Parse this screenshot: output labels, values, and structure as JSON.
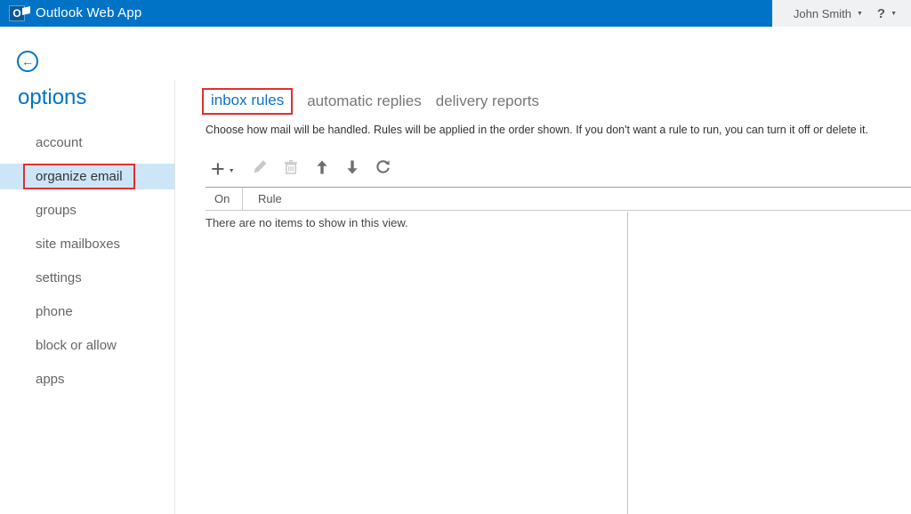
{
  "glyphs": {
    "caret_down": "▼",
    "plus": "+",
    "back_arrow": "←"
  },
  "accent_color": "#0173C7",
  "topbar": {
    "logo_letter": "O",
    "app_title": "Outlook Web App",
    "user_name": "John Smith",
    "help_label": "?",
    "bar_color": "#0173C7",
    "user_area_bg": "#EFF1F2"
  },
  "sidebar": {
    "title": "options",
    "active_item_bg": "#CDE6F7",
    "items": [
      {
        "label": "account",
        "active": false
      },
      {
        "label": "organize email",
        "active": true,
        "annotated": true
      },
      {
        "label": "groups",
        "active": false
      },
      {
        "label": "site mailboxes",
        "active": false
      },
      {
        "label": "settings",
        "active": false
      },
      {
        "label": "phone",
        "active": false
      },
      {
        "label": "block or allow",
        "active": false
      },
      {
        "label": "apps",
        "active": false
      }
    ]
  },
  "main": {
    "tabs": [
      {
        "label": "inbox rules",
        "active": true,
        "annotated": true
      },
      {
        "label": "automatic replies",
        "active": false
      },
      {
        "label": "delivery reports",
        "active": false
      }
    ],
    "description": "Choose how mail will be handled. Rules will be applied in the order shown. If you don't want a rule to run, you can turn it off or delete it.",
    "toolbar": {
      "buttons": [
        {
          "name": "new",
          "icon": "plus-icon",
          "enabled": true
        },
        {
          "name": "edit",
          "icon": "pencil-icon",
          "enabled": false
        },
        {
          "name": "delete",
          "icon": "trash-icon",
          "enabled": false
        },
        {
          "name": "move-up",
          "icon": "arrow-up-icon",
          "enabled": true
        },
        {
          "name": "move-down",
          "icon": "arrow-down-icon",
          "enabled": true
        },
        {
          "name": "refresh",
          "icon": "refresh-icon",
          "enabled": true
        }
      ]
    },
    "table": {
      "columns": [
        "On",
        "Rule"
      ],
      "empty_message": "There are no items to show in this view."
    }
  },
  "annotations": {
    "box_color": "#E02F2F",
    "targets": [
      "organize email",
      "inbox rules"
    ]
  }
}
